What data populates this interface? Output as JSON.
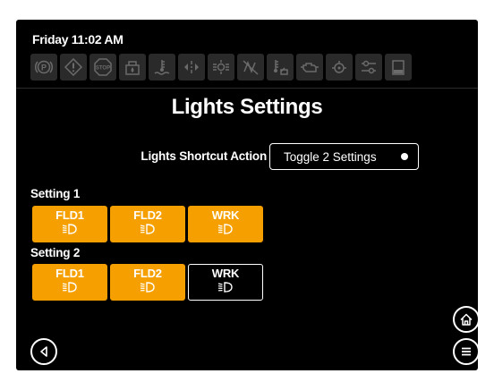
{
  "status": {
    "time": "Friday 11:02 AM"
  },
  "telltales": [
    {
      "icon": "park-brake-icon"
    },
    {
      "icon": "warning-icon"
    },
    {
      "icon": "stop-icon",
      "text": "STOP"
    },
    {
      "icon": "fuel-water-icon"
    },
    {
      "icon": "coolant-icon"
    },
    {
      "icon": "turn-signal-icon"
    },
    {
      "icon": "hazard-lights-icon"
    },
    {
      "icon": "regen-disabled-icon"
    },
    {
      "icon": "hydraulic-temp-icon"
    },
    {
      "icon": "engine-icon"
    },
    {
      "icon": "oil-pressure-icon"
    },
    {
      "icon": "transmission-icon"
    },
    {
      "icon": "fuel-level-icon"
    }
  ],
  "page": {
    "title": "Lights Settings"
  },
  "shortcut": {
    "label": "Lights Shortcut Action",
    "value": "Toggle 2 Settings"
  },
  "settings": [
    {
      "label": "Setting 1",
      "buttons": [
        {
          "label": "FLD1",
          "state": "on"
        },
        {
          "label": "FLD2",
          "state": "on"
        },
        {
          "label": "WRK",
          "state": "on"
        }
      ]
    },
    {
      "label": "Setting 2",
      "buttons": [
        {
          "label": "FLD1",
          "state": "on"
        },
        {
          "label": "FLD2",
          "state": "on"
        },
        {
          "label": "WRK",
          "state": "off"
        }
      ]
    }
  ],
  "colors": {
    "accent": "#f5a000",
    "background": "#000000",
    "foreground": "#ffffff"
  }
}
